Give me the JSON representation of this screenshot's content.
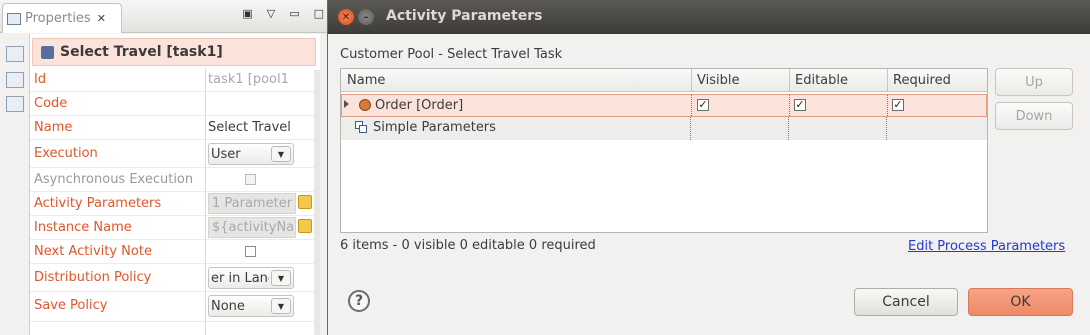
{
  "properties_view": {
    "tab_label": "Properties",
    "title": "Select Travel [task1]",
    "rows": [
      {
        "key": "Id",
        "value": "task1  [pool1"
      },
      {
        "key": "Code",
        "value": ""
      },
      {
        "key": "Name",
        "value": "Select Travel"
      },
      {
        "key": "Execution",
        "value": "User"
      },
      {
        "key": "Asynchronous Execution",
        "value": ""
      },
      {
        "key": "Activity Parameters",
        "value": "1 Parameter"
      },
      {
        "key": "Instance Name",
        "value": "${activityNam"
      },
      {
        "key": "Next Activity Note",
        "value": ""
      },
      {
        "key": "Distribution Policy",
        "value": "er in Lane"
      },
      {
        "key": "Save Policy",
        "value": "None"
      }
    ]
  },
  "dialog": {
    "title": "Activity Parameters",
    "subtitle": "Customer Pool  - Select Travel Task",
    "columns": [
      "Name",
      "Visible",
      "Editable",
      "Required"
    ],
    "rows": [
      {
        "name": "Order [Order]",
        "visible": true,
        "editable": true,
        "required": true
      },
      {
        "name": "Simple Parameters"
      }
    ],
    "up_label": "Up",
    "down_label": "Down",
    "status": "6 items - 0 visible  0 editable  0 required",
    "edit_link": "Edit Process Parameters",
    "help_label": "?",
    "cancel_label": "Cancel",
    "ok_label": "OK",
    "checkmark": "✓"
  },
  "colors": {
    "selection_bg": "#fbe3dc",
    "ok_button": "#ef8a66",
    "link": "#1f3bd3",
    "label_orange": "#e0562a"
  }
}
